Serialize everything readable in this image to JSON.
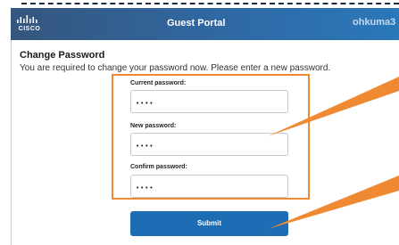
{
  "header": {
    "logo_text": "CISCO",
    "title": "Guest Portal",
    "user": "ohkuma3"
  },
  "page": {
    "title": "Change Password",
    "description": "You are required to change your password now. Please enter a new password."
  },
  "form": {
    "current_password_label": "Current password:",
    "current_password_value": "••••",
    "new_password_label": "New password:",
    "new_password_value": "••••",
    "confirm_password_label": "Confirm password:",
    "confirm_password_value": "••••",
    "submit_label": "Submit"
  },
  "colors": {
    "header": "#2f6aa7",
    "accent": "#ef8a33",
    "button": "#1c6db4"
  }
}
